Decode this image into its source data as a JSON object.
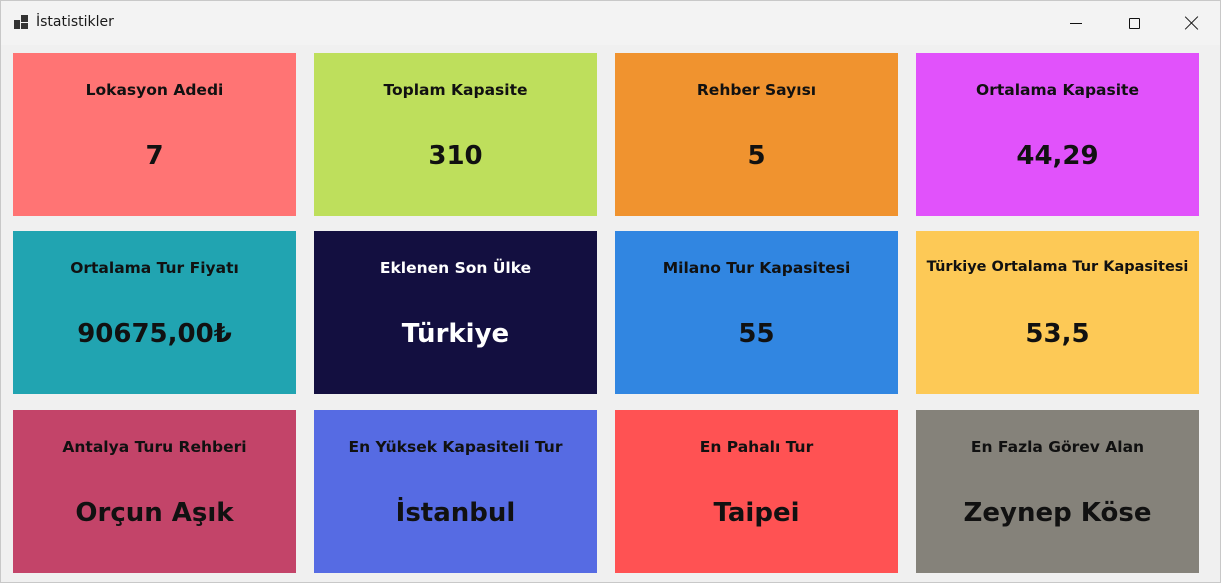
{
  "window": {
    "title": "İstatistikler",
    "icon": "app-window-icon",
    "controls": [
      "minimize-icon",
      "maximize-icon",
      "close-icon"
    ]
  },
  "cards": [
    {
      "label": "Lokasyon Adedi",
      "value": "7",
      "color": "#ff7474"
    },
    {
      "label": "Toplam Kapasite",
      "value": "310",
      "color": "#bedf5c"
    },
    {
      "label": "Rehber Sayısı",
      "value": "5",
      "color": "#f0932f"
    },
    {
      "label": "Ortalama Kapasite",
      "value": "44,29",
      "color": "#e152fb"
    },
    {
      "label": "Ortalama Tur Fiyatı",
      "value": "90675,00₺",
      "color": "#21a4b1"
    },
    {
      "label": "Eklenen Son Ülke",
      "value": "Türkiye",
      "color": "#130f40"
    },
    {
      "label": "Milano Tur Kapasitesi",
      "value": "55",
      "color": "#3186e1"
    },
    {
      "label": "Türkiye Ortalama Tur Kapasitesi",
      "value": "53,5",
      "color": "#fdc956"
    },
    {
      "label": "Antalya Turu Rehberi",
      "value": "Orçun Aşık",
      "color": "#c34469"
    },
    {
      "label": "En Yüksek Kapasiteli Tur",
      "value": "İstanbul",
      "color": "#566be3"
    },
    {
      "label": "En Pahalı Tur",
      "value": "Taipei",
      "color": "#ff5253"
    },
    {
      "label": "En Fazla Görev Alan",
      "value": "Zeynep Köse",
      "color": "#85827a"
    }
  ]
}
